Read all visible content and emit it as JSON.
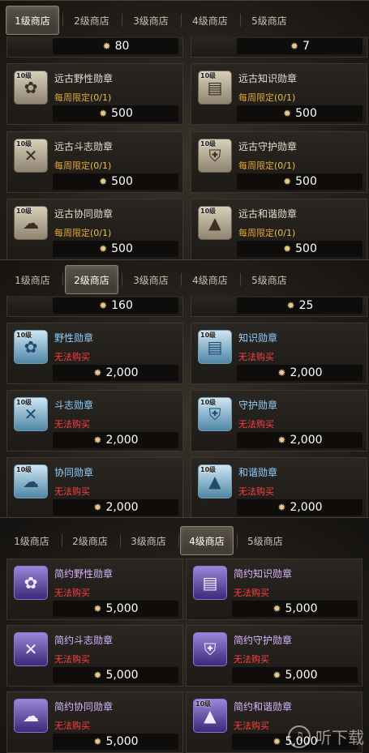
{
  "panels": [
    {
      "tabs": [
        "1级商店",
        "2级商店",
        "3级商店",
        "4级商店",
        "5级商店"
      ],
      "active_tab": 0,
      "top_prices": [
        "80",
        "7"
      ],
      "items": [
        {
          "name": "远古野性勋章",
          "level": "10级",
          "limit_label": "每周限定",
          "limit_count": "(0/1)",
          "price": "500",
          "icon": "paw-medal-icon"
        },
        {
          "name": "远古知识勋章",
          "level": "10级",
          "limit_label": "每周限定",
          "limit_count": "(0/1)",
          "price": "500",
          "icon": "book-medal-icon"
        },
        {
          "name": "远古斗志勋章",
          "level": "10级",
          "limit_label": "每周限定",
          "limit_count": "(0/1)",
          "price": "500",
          "icon": "crossed-swords-medal-icon"
        },
        {
          "name": "远古守护勋章",
          "level": "10级",
          "limit_label": "每周限定",
          "limit_count": "(0/1)",
          "price": "500",
          "icon": "shield-medal-icon"
        },
        {
          "name": "远古协同勋章",
          "level": "10级",
          "limit_label": "每周限定",
          "limit_count": "(0/1)",
          "price": "500",
          "icon": "cloud-medal-icon"
        },
        {
          "name": "远古和谐勋章",
          "level": "10级",
          "limit_label": "每周限定",
          "limit_count": "(0/1)",
          "price": "500",
          "icon": "triangle-medal-icon"
        }
      ]
    },
    {
      "tabs": [
        "1级商店",
        "2级商店",
        "3级商店",
        "4级商店",
        "5级商店"
      ],
      "active_tab": 1,
      "top_prices": [
        "160",
        "25"
      ],
      "items": [
        {
          "name": "野性勋章",
          "level": "10级",
          "status": "无法购买",
          "price": "2,000",
          "icon": "paw-medal-icon"
        },
        {
          "name": "知识勋章",
          "level": "10级",
          "status": "无法购买",
          "price": "2,000",
          "icon": "book-medal-icon"
        },
        {
          "name": "斗志勋章",
          "level": "10级",
          "status": "无法购买",
          "price": "2,000",
          "icon": "crossed-swords-medal-icon"
        },
        {
          "name": "守护勋章",
          "level": "10级",
          "status": "无法购买",
          "price": "2,000",
          "icon": "shield-medal-icon"
        },
        {
          "name": "协同勋章",
          "level": "10级",
          "status": "无法购买",
          "price": "2,000",
          "icon": "cloud-medal-icon"
        },
        {
          "name": "和谐勋章",
          "level": "10级",
          "status": "无法购买",
          "price": "2,000",
          "icon": "triangle-medal-icon"
        }
      ]
    },
    {
      "tabs": [
        "1级商店",
        "2级商店",
        "3级商店",
        "4级商店",
        "5级商店"
      ],
      "active_tab": 3,
      "items": [
        {
          "name": "简约野性勋章",
          "level": "10级",
          "status": "无法购买",
          "price": "5,000",
          "icon": "paw-medal-icon"
        },
        {
          "name": "简约知识勋章",
          "level": "10级",
          "status": "无法购买",
          "price": "5,000",
          "icon": "book-medal-icon"
        },
        {
          "name": "简约斗志勋章",
          "level": "10级",
          "status": "无法购买",
          "price": "5,000",
          "icon": "crossed-swords-medal-icon"
        },
        {
          "name": "简约守护勋章",
          "level": "10级",
          "status": "无法购买",
          "price": "5,000",
          "icon": "shield-medal-icon"
        },
        {
          "name": "简约协同勋章",
          "level": "10级",
          "status": "无法购买",
          "price": "5,000",
          "icon": "cloud-medal-icon"
        },
        {
          "name": "简约和谐勋章",
          "level": "10级",
          "status": "无法购买",
          "price": "5,000",
          "icon": "triangle-medal-icon"
        }
      ]
    }
  ],
  "currency_icon": "gear-coin-icon",
  "watermark": {
    "text": "听下载",
    "icon": "headphone-icon"
  },
  "colors": {
    "limit": "#e0a636",
    "unavailable": "#ff4040",
    "tier2_name": "#8fd0ff",
    "tier4_name": "#d8b6ff"
  }
}
